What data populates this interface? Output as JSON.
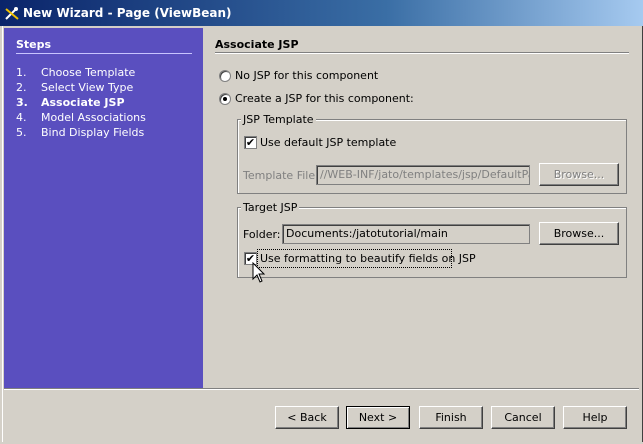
{
  "window": {
    "title": "New Wizard - Page (ViewBean)"
  },
  "steps": {
    "heading": "Steps",
    "items": [
      {
        "num": "1.",
        "label": "Choose Template"
      },
      {
        "num": "2.",
        "label": "Select View Type"
      },
      {
        "num": "3.",
        "label": "Associate JSP"
      },
      {
        "num": "4.",
        "label": "Model Associations"
      },
      {
        "num": "5.",
        "label": "Bind Display Fields"
      }
    ],
    "current_index": 2
  },
  "panel": {
    "title": "Associate JSP",
    "radio_no_jsp": "No JSP for this component",
    "radio_create_jsp": "Create a JSP for this component:",
    "selected_radio": "create_jsp",
    "jsp_template": {
      "legend": "JSP Template",
      "use_default_label": "Use default JSP template",
      "use_default_checked": true,
      "template_file_label": "Template File:",
      "template_file_value": "//WEB-INF/jato/templates/jsp/DefaultPage.jsp",
      "browse_label": "Browse..."
    },
    "target_jsp": {
      "legend": "Target JSP",
      "folder_label": "Folder:",
      "folder_value": "Documents:/jatotutorial/main",
      "browse_label": "Browse...",
      "formatting_label": "Use formatting to beautify fields on JSP",
      "formatting_checked": true
    }
  },
  "buttons": {
    "back": "< Back",
    "next": "Next >",
    "finish": "Finish",
    "cancel": "Cancel",
    "help": "Help"
  }
}
